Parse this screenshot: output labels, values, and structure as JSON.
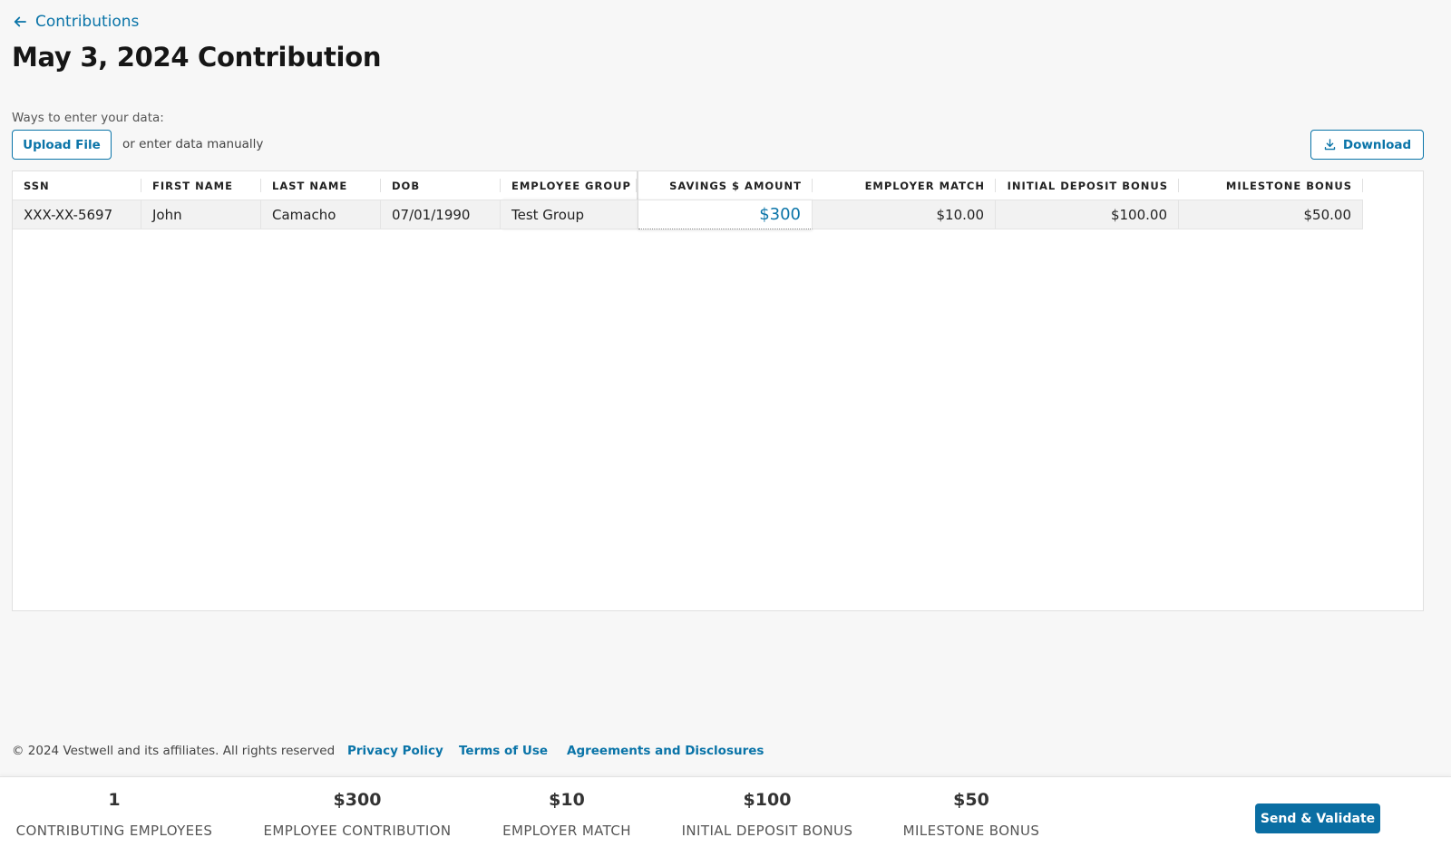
{
  "header": {
    "back_label": "Contributions",
    "title": "May 3, 2024 Contribution"
  },
  "data_entry": {
    "ways_label": "Ways to enter your data:",
    "upload_label": "Upload File",
    "manual_text": "or enter data manually",
    "download_label": "Download"
  },
  "grid": {
    "columns": [
      "SSN",
      "FIRST NAME",
      "LAST NAME",
      "DOB",
      "EMPLOYEE GROUP",
      "SAVINGS $ AMOUNT",
      "EMPLOYER MATCH",
      "INITIAL DEPOSIT BONUS",
      "MILESTONE BONUS"
    ],
    "rows": [
      {
        "ssn": "XXX-XX-5697",
        "first_name": "John",
        "last_name": "Camacho",
        "dob": "07/01/1990",
        "employee_group": "Test Group",
        "savings_amount": "$300",
        "employer_match": "$10.00",
        "initial_deposit_bonus": "$100.00",
        "milestone_bonus": "$50.00"
      }
    ]
  },
  "footer": {
    "copyright": "© 2024 Vestwell and its affiliates. All rights reserved",
    "privacy": "Privacy Policy",
    "terms": "Terms of Use",
    "agreements": "Agreements and Disclosures"
  },
  "summary": {
    "contributing_employees": {
      "value": "1",
      "label": "CONTRIBUTING EMPLOYEES"
    },
    "employee_contribution": {
      "value": "$300",
      "label": "EMPLOYEE CONTRIBUTION"
    },
    "employer_match": {
      "value": "$10",
      "label": "EMPLOYER MATCH"
    },
    "initial_deposit_bonus": {
      "value": "$100",
      "label": "INITIAL DEPOSIT BONUS"
    },
    "milestone_bonus": {
      "value": "$50",
      "label": "MILESTONE BONUS"
    },
    "send_label": "Send & Validate"
  },
  "colors": {
    "accent": "#0a74a8",
    "primary_button": "#0a6ea3",
    "page_background": "#f7f7f7"
  }
}
